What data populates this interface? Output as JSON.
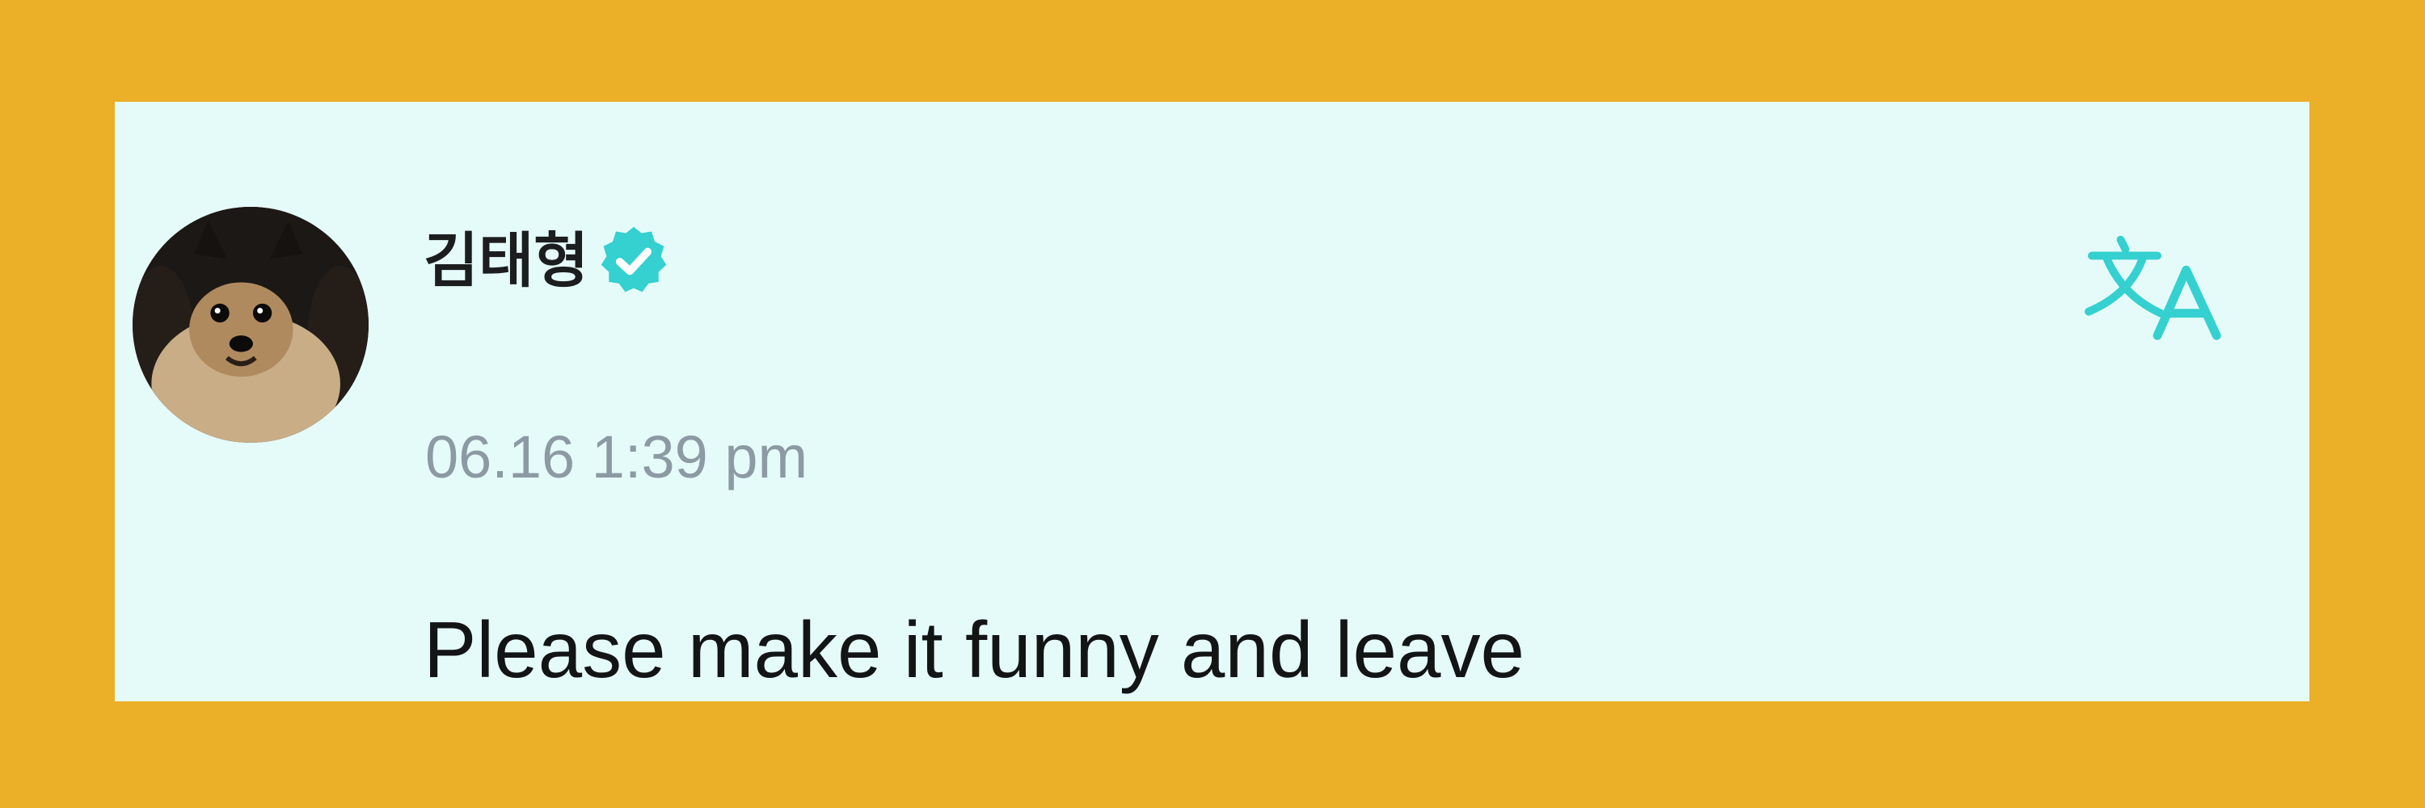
{
  "post": {
    "author_name": "김태형",
    "verified": true,
    "timestamp": "06.16 1:39 pm",
    "text": "Please make it funny and leave"
  },
  "icons": {
    "avatar": "avatar-photo-pomeranian",
    "verified": "verified-badge-icon",
    "translate": "translate-icon"
  },
  "colors": {
    "frame_background": "#ebb027",
    "card_background": "#e5fbf9",
    "accent": "#35d0d0",
    "timestamp": "#8c9aa3",
    "text": "#121416"
  }
}
